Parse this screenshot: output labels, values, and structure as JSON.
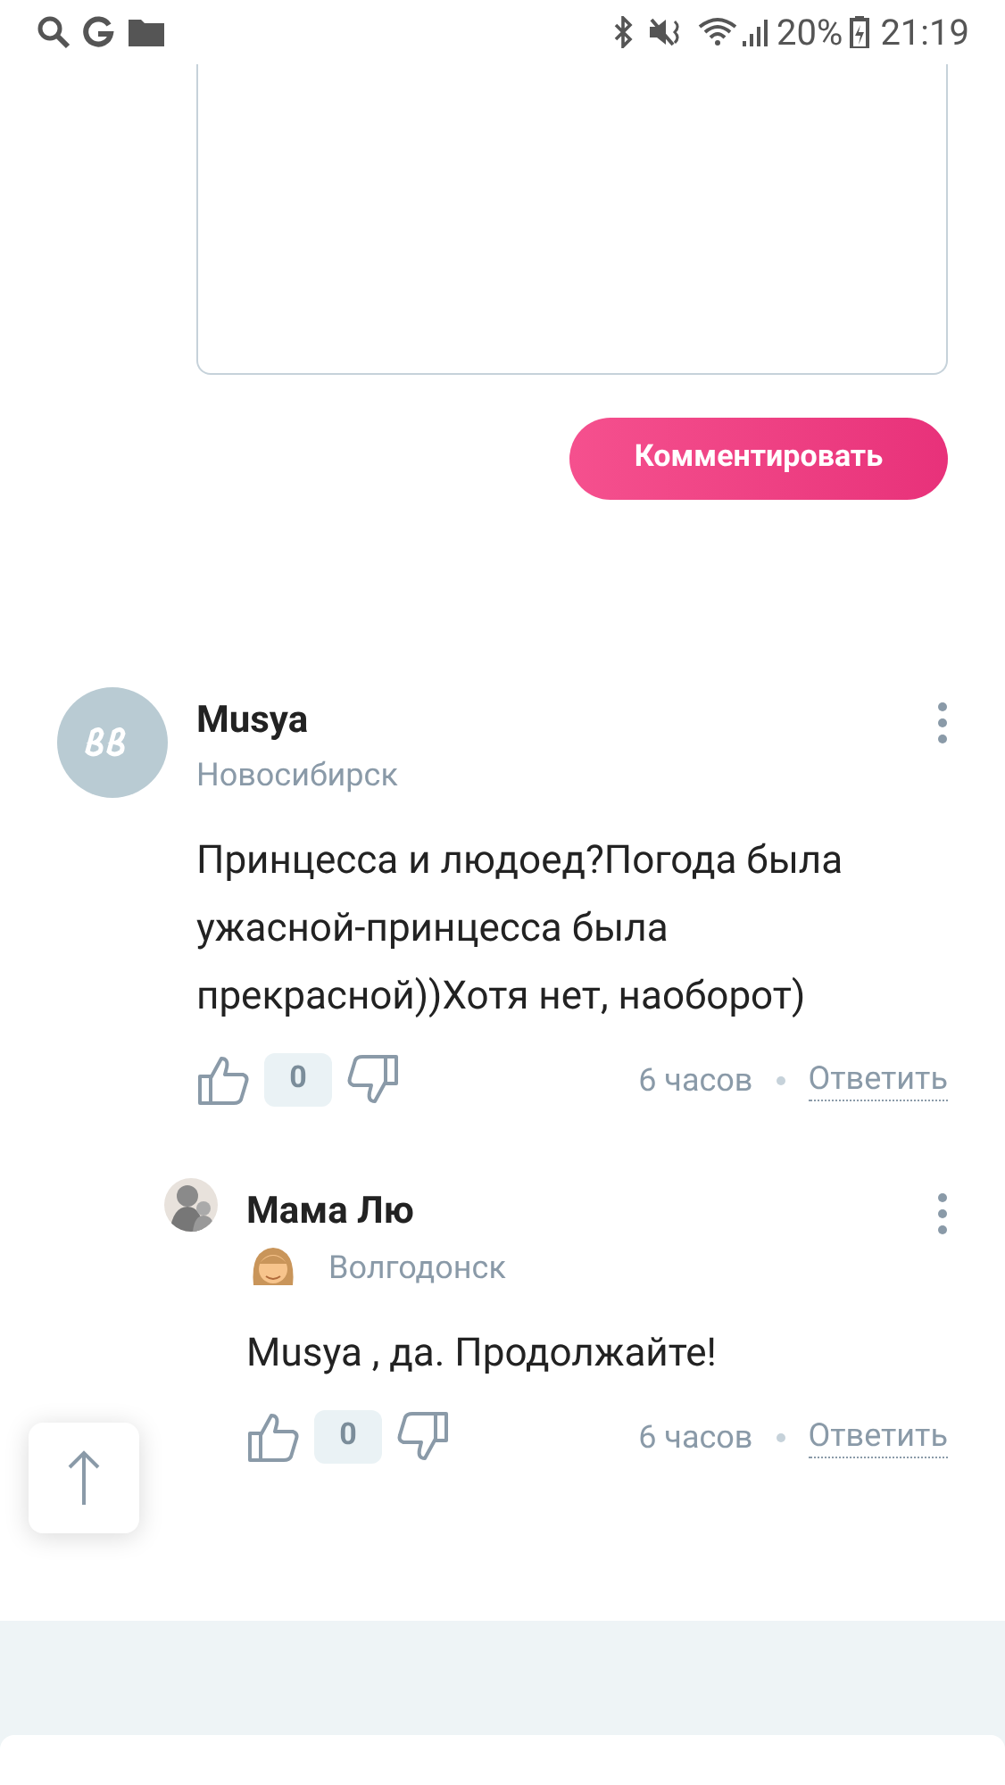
{
  "status_bar": {
    "battery": "20%",
    "time": "21:19"
  },
  "comment_form": {
    "button": "Комментировать"
  },
  "comments": [
    {
      "author": "Musya",
      "avatar": {
        "kind": "logo"
      },
      "city": "Новосибирск",
      "text": "Принцесса и людоед?Погода была ужасной-принцесса была прекрасной))Хотя нет, наоборот)",
      "likes": "0",
      "time": "6 часов",
      "reply": "Ответить",
      "children": [
        {
          "author": "Мама Лю",
          "badge": true,
          "city": "Волгодонск",
          "text": "Musya , да. Продолжайте!",
          "likes": "0",
          "time": "6 часов",
          "reply": "Ответить"
        }
      ]
    }
  ]
}
